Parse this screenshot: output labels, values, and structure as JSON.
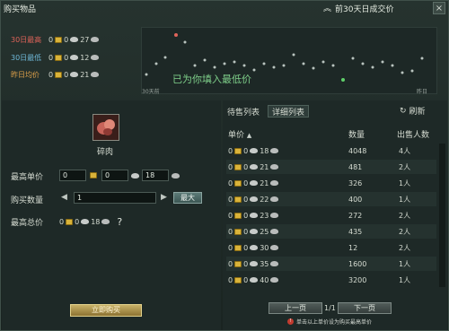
{
  "window": {
    "title": "购买物品",
    "history_title": "前30天日成交价"
  },
  "stats": [
    {
      "label": "30日最高",
      "gold": "0",
      "silver": "0",
      "copper": "27",
      "color": "#e0645a"
    },
    {
      "label": "30日最低",
      "gold": "0",
      "silver": "0",
      "copper": "12",
      "color": "#6fb9d9"
    },
    {
      "label": "昨日均价",
      "gold": "0",
      "silver": "0",
      "copper": "21",
      "color": "#e0a24a"
    }
  ],
  "chart": {
    "hint": "已为你填入最低价",
    "left_label": "30天前",
    "right_label": "昨日"
  },
  "item": {
    "name": "碎肉"
  },
  "form": {
    "max_unit_price_label": "最高单价",
    "price_gold": "0",
    "price_silver": "0",
    "price_copper": "18",
    "quantity_label": "购买数量",
    "quantity": "1",
    "max_button": "最大",
    "total_label": "最高总价",
    "total_gold": "0",
    "total_silver": "0",
    "total_copper": "18",
    "help": "?",
    "buy_button": "立即购买"
  },
  "tabs": {
    "sale_list": "待售列表",
    "detail_list": "详细列表",
    "refresh": "刷新"
  },
  "table": {
    "headers": {
      "price": "单价",
      "quantity": "数量",
      "sellers": "出售人数"
    },
    "rows": [
      {
        "gold": "0",
        "silver": "0",
        "copper": "18",
        "qty": "4048",
        "sellers": "4人"
      },
      {
        "gold": "0",
        "silver": "0",
        "copper": "21",
        "qty": "481",
        "sellers": "2人"
      },
      {
        "gold": "0",
        "silver": "0",
        "copper": "21",
        "qty": "326",
        "sellers": "1人"
      },
      {
        "gold": "0",
        "silver": "0",
        "copper": "22",
        "qty": "400",
        "sellers": "1人"
      },
      {
        "gold": "0",
        "silver": "0",
        "copper": "23",
        "qty": "272",
        "sellers": "2人"
      },
      {
        "gold": "0",
        "silver": "0",
        "copper": "25",
        "qty": "435",
        "sellers": "2人"
      },
      {
        "gold": "0",
        "silver": "0",
        "copper": "30",
        "qty": "12",
        "sellers": "2人"
      },
      {
        "gold": "0",
        "silver": "0",
        "copper": "35",
        "qty": "1600",
        "sellers": "1人"
      },
      {
        "gold": "0",
        "silver": "0",
        "copper": "40",
        "qty": "3200",
        "sellers": "1人"
      }
    ]
  },
  "pager": {
    "prev": "上一页",
    "info": "1/1",
    "next": "下一页",
    "note": "单击以上单价设为购买最高单价"
  }
}
